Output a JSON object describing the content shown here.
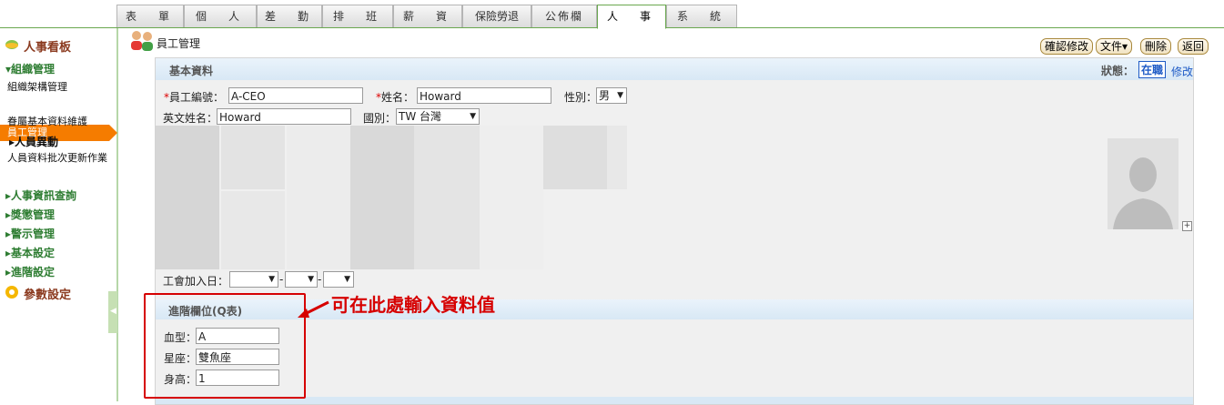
{
  "tabs": [
    {
      "label": "表　單"
    },
    {
      "label": "個　人"
    },
    {
      "label": "差　勤"
    },
    {
      "label": "排　班"
    },
    {
      "label": "薪　資"
    },
    {
      "label": "保險勞退"
    },
    {
      "label": "公佈欄"
    },
    {
      "label": "人　事"
    },
    {
      "label": "系　統"
    }
  ],
  "active_tab": "人　事",
  "sidebar": {
    "title": "人事看板",
    "org_section": "▾組織管理",
    "org_items": [
      "組織架構管理",
      "員工管理",
      "眷屬基本資料維護"
    ],
    "active_item": "員工管理",
    "movement": "▸人員異動",
    "batch_update": "人員資料批次更新作業",
    "sections": [
      "▸人事資訊查詢",
      "▸獎懲管理",
      "▸警示管理",
      "▸基本設定",
      "▸進階設定"
    ],
    "params": "參數設定"
  },
  "page_title": "員工管理",
  "header_buttons": {
    "confirm": "確認修改",
    "file": "文件▾",
    "delete": "刪除",
    "back": "返回"
  },
  "basic": {
    "header": "基本資料",
    "status_label": "狀態：",
    "status_value": "在職",
    "edit_link": "修改",
    "emp_no_label": "員工編號：",
    "emp_no": "A-CEO",
    "name_label": "姓名：",
    "name": "Howard",
    "gender_label": "性別：",
    "gender": "男",
    "en_name_label": "英文姓名：",
    "en_name": "Howard",
    "country_label": "國別：",
    "country": "TW 台灣",
    "union_label": "工會加入日：",
    "union_sep": "-"
  },
  "advanced": {
    "header": "進階欄位(Q表)",
    "blood_label": "血型：",
    "blood": "A",
    "star_label": "星座：",
    "star": "雙魚座",
    "height_label": "身高：",
    "height": "1"
  },
  "callout": "可在此處輸入資料值",
  "colors": {
    "accent_green": "#6aa84f",
    "active_orange": "#f57c00",
    "highlight_red": "#d60000",
    "link_blue": "#1e5bc6"
  }
}
